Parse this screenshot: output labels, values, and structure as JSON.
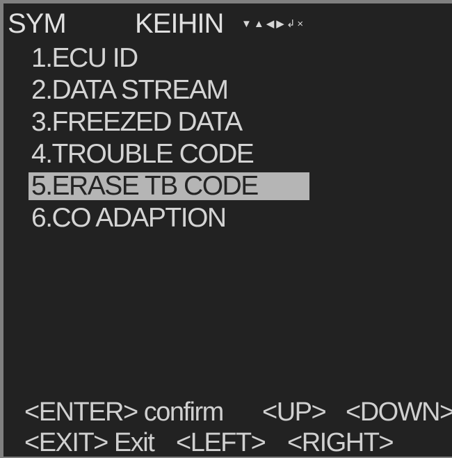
{
  "header": {
    "brand": "SYM",
    "ecu_type": "KEIHIN",
    "nav_icons": [
      {
        "name": "down-arrow-icon",
        "glyph": "▼"
      },
      {
        "name": "up-arrow-icon",
        "glyph": "▲"
      },
      {
        "name": "left-arrow-icon",
        "glyph": "◀"
      },
      {
        "name": "right-arrow-icon",
        "glyph": "▶"
      },
      {
        "name": "enter-icon",
        "glyph": "↲"
      },
      {
        "name": "close-icon",
        "glyph": "×"
      }
    ]
  },
  "menu": {
    "items": [
      {
        "label": "1.ECU ID",
        "selected": false
      },
      {
        "label": "2.DATA STREAM",
        "selected": false
      },
      {
        "label": "3.FREEZED DATA",
        "selected": false
      },
      {
        "label": "4.TROUBLE CODE",
        "selected": false
      },
      {
        "label": "5.ERASE TB CODE",
        "selected": true
      },
      {
        "label": "6.CO ADAPTION",
        "selected": false
      }
    ]
  },
  "hints": {
    "enter": "<ENTER> confirm",
    "up": "<UP>",
    "down": "<DOWN>",
    "exit": "<EXIT> Exit",
    "left": "<LEFT>",
    "right": "<RIGHT>"
  },
  "colors": {
    "background": "#222222",
    "text": "#d4d4d4",
    "highlight": "#b5b5b5",
    "highlight_text": "#242424",
    "border": "#808080"
  }
}
